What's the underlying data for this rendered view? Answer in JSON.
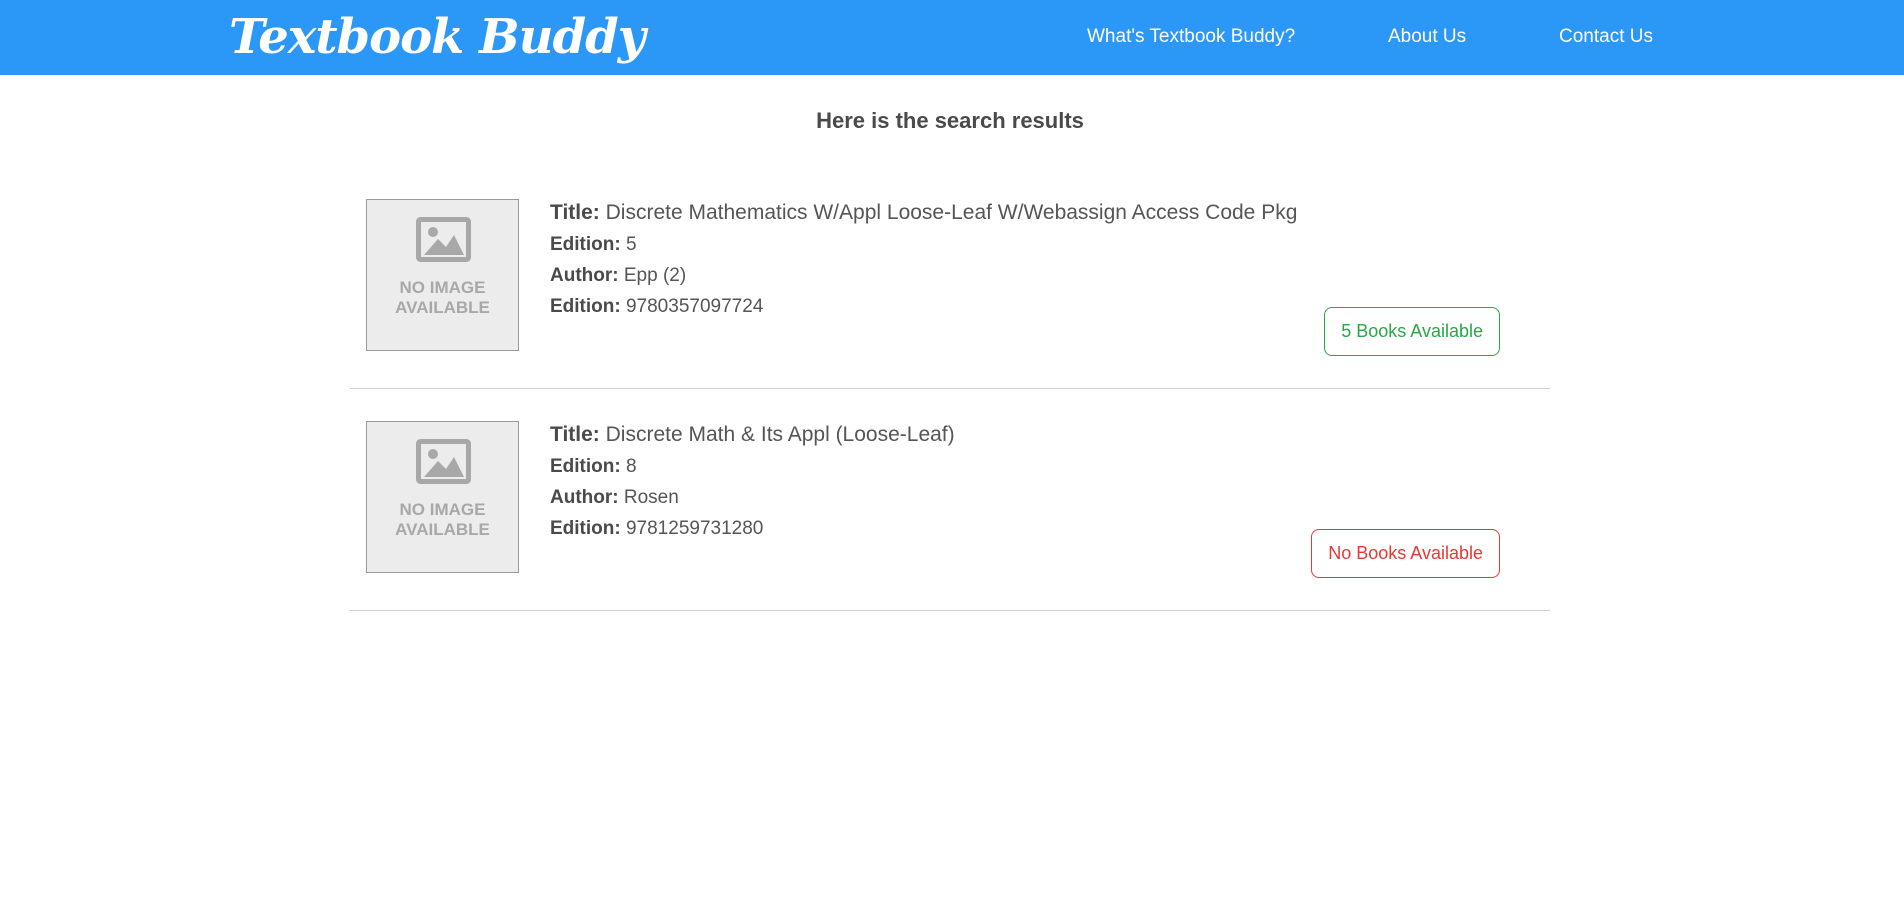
{
  "header": {
    "brand": "Textbook Buddy",
    "nav": [
      {
        "label": "What's Textbook Buddy?"
      },
      {
        "label": "About Us"
      },
      {
        "label": "Contact Us"
      }
    ],
    "background_color": "#2b98f7"
  },
  "main": {
    "heading": "Here is the search results",
    "results": [
      {
        "image_text_1": "NO IMAGE",
        "image_text_2": "AVAILABLE",
        "title_label": "Title:",
        "title": "Discrete Mathematics W/Appl Loose-Leaf W/Webassign Access Code Pkg",
        "edition_label": "Edition:",
        "edition": "5",
        "author_label": "Author:",
        "author": "Epp (2)",
        "isbn_label": "Edition:",
        "isbn": "9780357097724",
        "availability": "5 Books Available",
        "availability_color": "#28a745"
      },
      {
        "image_text_1": "NO IMAGE",
        "image_text_2": "AVAILABLE",
        "title_label": "Title:",
        "title": "Discrete Math & Its Appl (Loose-Leaf)",
        "edition_label": "Edition:",
        "edition": "8",
        "author_label": "Author:",
        "author": "Rosen",
        "isbn_label": "Edition:",
        "isbn": "9781259731280",
        "availability": "No Books Available",
        "availability_color": "#e53935"
      }
    ]
  }
}
